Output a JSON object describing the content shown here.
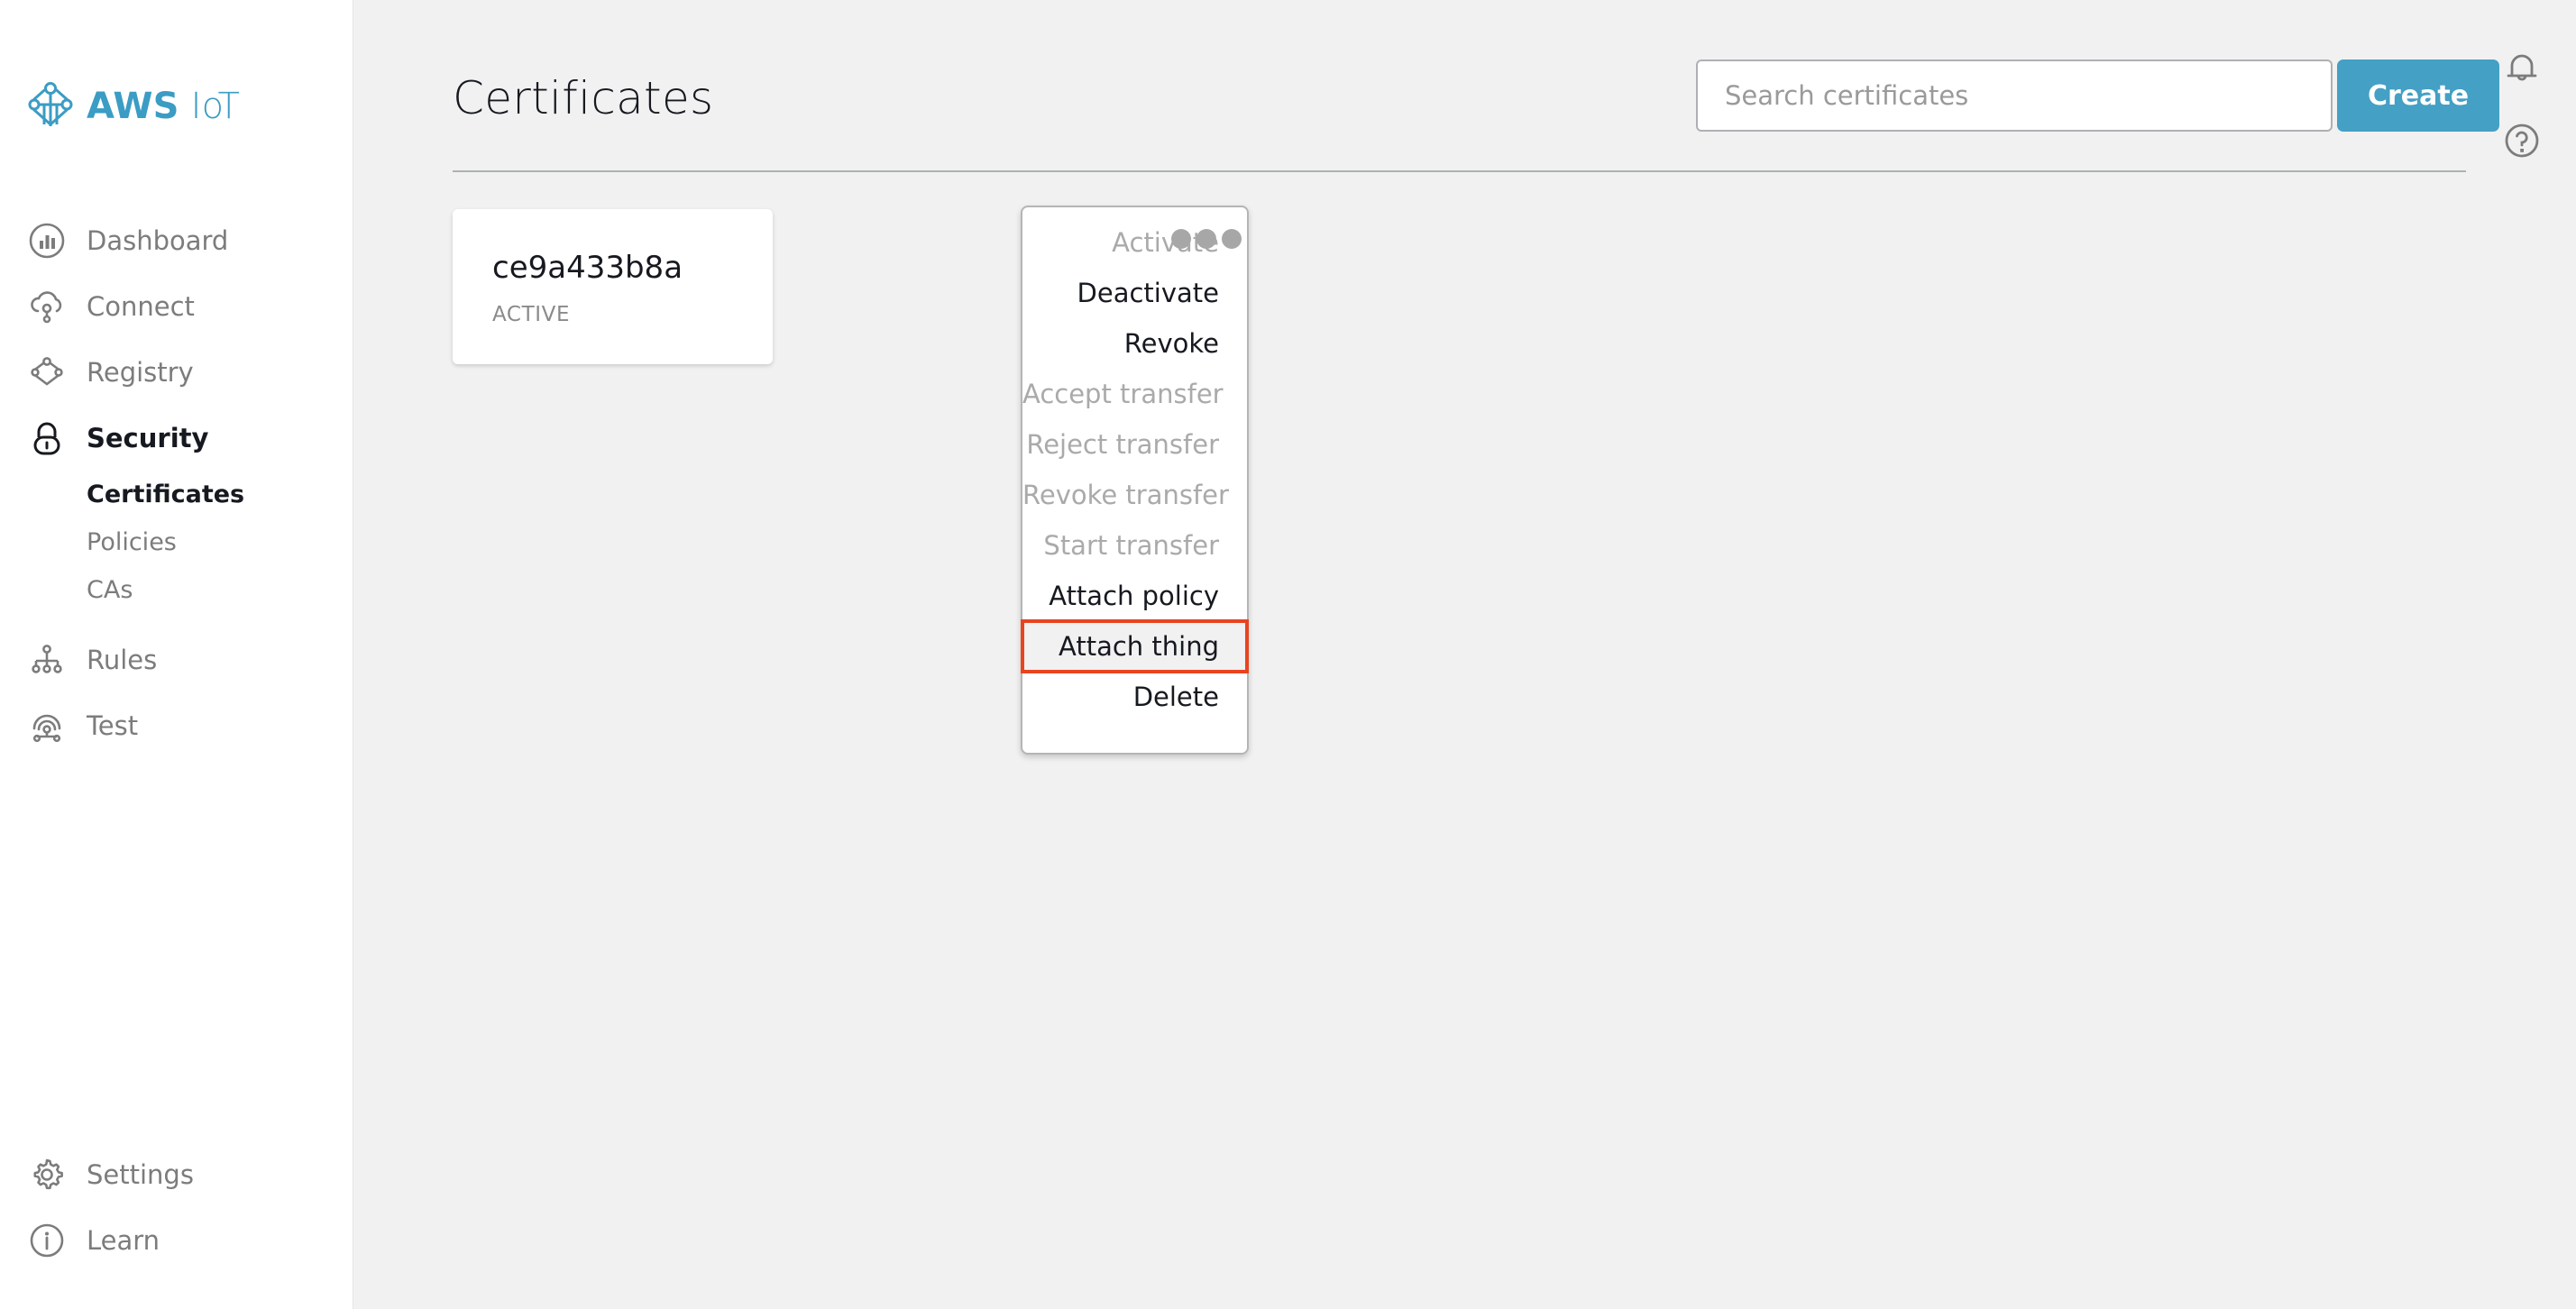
{
  "brand": {
    "aws": "AWS",
    "iot": "IoT"
  },
  "sidebar": {
    "items": [
      {
        "label": "Dashboard",
        "icon": "chart-bar-circle-icon",
        "active": false
      },
      {
        "label": "Connect",
        "icon": "cloud-connect-icon",
        "active": false
      },
      {
        "label": "Registry",
        "icon": "registry-nodes-icon",
        "active": false
      },
      {
        "label": "Security",
        "icon": "lock-icon",
        "active": true
      }
    ],
    "sub_items": [
      {
        "label": "Certificates",
        "active": true
      },
      {
        "label": "Policies",
        "active": false
      },
      {
        "label": "CAs",
        "active": false
      }
    ],
    "items_after": [
      {
        "label": "Rules",
        "icon": "rules-tree-icon",
        "active": false
      },
      {
        "label": "Test",
        "icon": "signal-wifi-icon",
        "active": false
      }
    ],
    "bottom_items": [
      {
        "label": "Settings",
        "icon": "gear-icon"
      },
      {
        "label": "Learn",
        "icon": "info-circle-icon"
      }
    ]
  },
  "header": {
    "title": "Certificates",
    "search_placeholder": "Search certificates",
    "search_value": "",
    "create_label": "Create",
    "bell_icon": "bell-icon",
    "help_icon": "question-circle-icon"
  },
  "certificate": {
    "name": "ce9a433b8a",
    "status": "ACTIVE"
  },
  "menu": {
    "items": [
      {
        "label": "Activate",
        "disabled": true,
        "highlighted": false
      },
      {
        "label": "Deactivate",
        "disabled": false,
        "highlighted": false
      },
      {
        "label": "Revoke",
        "disabled": false,
        "highlighted": false
      },
      {
        "label": "Accept transfer",
        "disabled": true,
        "highlighted": false
      },
      {
        "label": "Reject transfer",
        "disabled": true,
        "highlighted": false
      },
      {
        "label": "Revoke transfer",
        "disabled": true,
        "highlighted": false
      },
      {
        "label": "Start transfer",
        "disabled": true,
        "highlighted": false
      },
      {
        "label": "Attach policy",
        "disabled": false,
        "highlighted": false
      },
      {
        "label": "Attach thing",
        "disabled": false,
        "highlighted": true
      },
      {
        "label": "Delete",
        "disabled": false,
        "highlighted": false
      }
    ]
  },
  "colors": {
    "brand_blue": "#3b9cc4",
    "button_blue": "#44a0c4",
    "highlight_red": "#e8441f",
    "page_bg": "#f1f1f1",
    "sidebar_bg": "#ffffff",
    "text_dark": "#16191f",
    "text_muted": "#7c7c7c",
    "text_disabled": "#aaaaaa"
  }
}
